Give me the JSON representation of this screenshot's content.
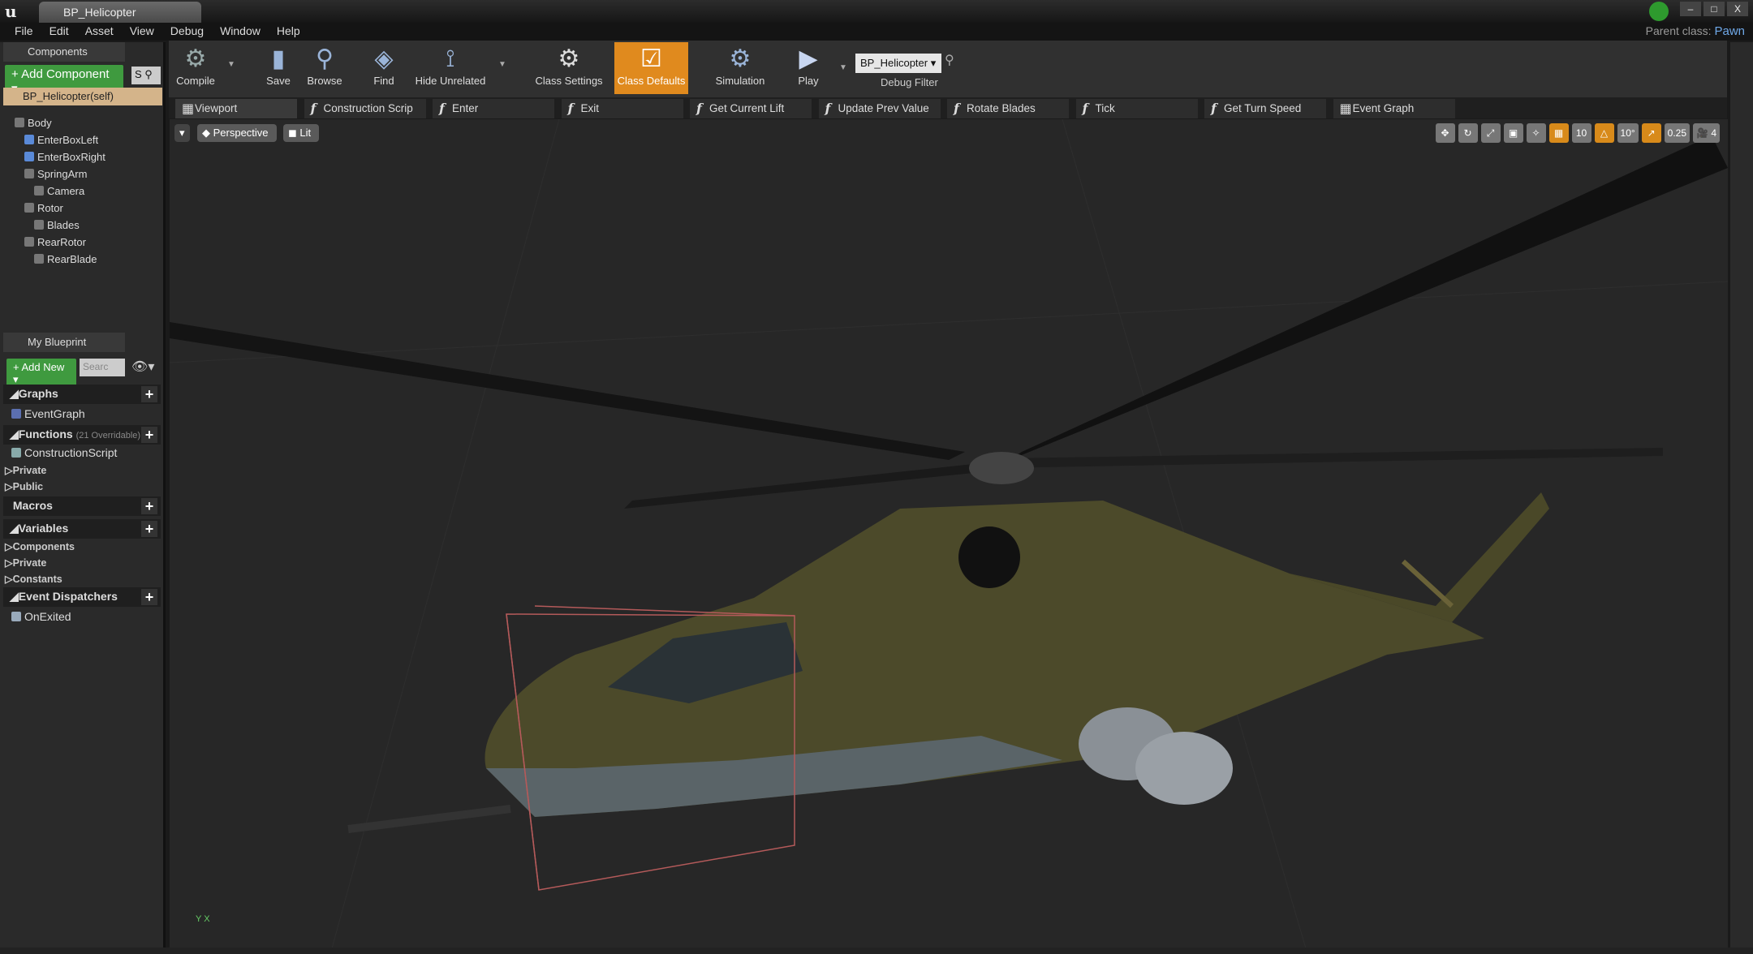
{
  "window": {
    "tab_title": "BP_Helicopter",
    "parent_class_label": "Parent class:",
    "parent_class": "Pawn"
  },
  "menu": [
    "File",
    "Edit",
    "Asset",
    "View",
    "Debug",
    "Window",
    "Help"
  ],
  "components": {
    "tab": "Components",
    "add_button": "Add Component",
    "search_placeholder": "S",
    "self": "BP_Helicopter(self)",
    "tree": [
      {
        "label": "Body",
        "depth": 0
      },
      {
        "label": "EnterBoxLeft",
        "depth": 1
      },
      {
        "label": "EnterBoxRight",
        "depth": 1
      },
      {
        "label": "SpringArm",
        "depth": 1
      },
      {
        "label": "Camera",
        "depth": 2
      },
      {
        "label": "Rotor",
        "depth": 1
      },
      {
        "label": "Blades",
        "depth": 2
      },
      {
        "label": "RearRotor",
        "depth": 1
      },
      {
        "label": "RearBlade",
        "depth": 2
      }
    ]
  },
  "my_blueprint": {
    "tab": "My Blueprint",
    "add_button": "Add New",
    "search_placeholder": "Searc",
    "graphs": "Graphs",
    "event_graph": "EventGraph",
    "functions": "Functions",
    "functions_note": "(21 Overridable)",
    "construction_script": "ConstructionScript",
    "private": "Private",
    "public": "Public",
    "macros": "Macros",
    "variables": "Variables",
    "var_components": "Components",
    "var_private": "Private",
    "var_constants": "Constants",
    "event_dispatchers": "Event Dispatchers",
    "on_exited": "OnExited"
  },
  "toolbar": {
    "compile": "Compile",
    "save": "Save",
    "browse": "Browse",
    "find": "Find",
    "hide_unrelated": "Hide Unrelated",
    "class_settings": "Class Settings",
    "class_defaults": "Class Defaults",
    "simulation": "Simulation",
    "play": "Play",
    "debug_object": "BP_Helicopter",
    "debug_filter": "Debug Filter"
  },
  "graph_tabs": [
    "Viewport",
    "Construction Scrip",
    "Enter",
    "Exit",
    "Get Current Lift",
    "Update Prev Value",
    "Rotate Blades",
    "Tick",
    "Get Turn Speed",
    "Event Graph"
  ],
  "viewport": {
    "perspective": "Perspective",
    "lit": "Lit",
    "grid_snap": "10",
    "rotation_snap": "10°",
    "scale_snap": "0.25",
    "camera_speed": "4",
    "axis_label": "Y X"
  },
  "colors": {
    "accent_orange": "#e08a1e",
    "green_button": "#3f9a3f",
    "parent_class_link": "#6fa8e8"
  }
}
